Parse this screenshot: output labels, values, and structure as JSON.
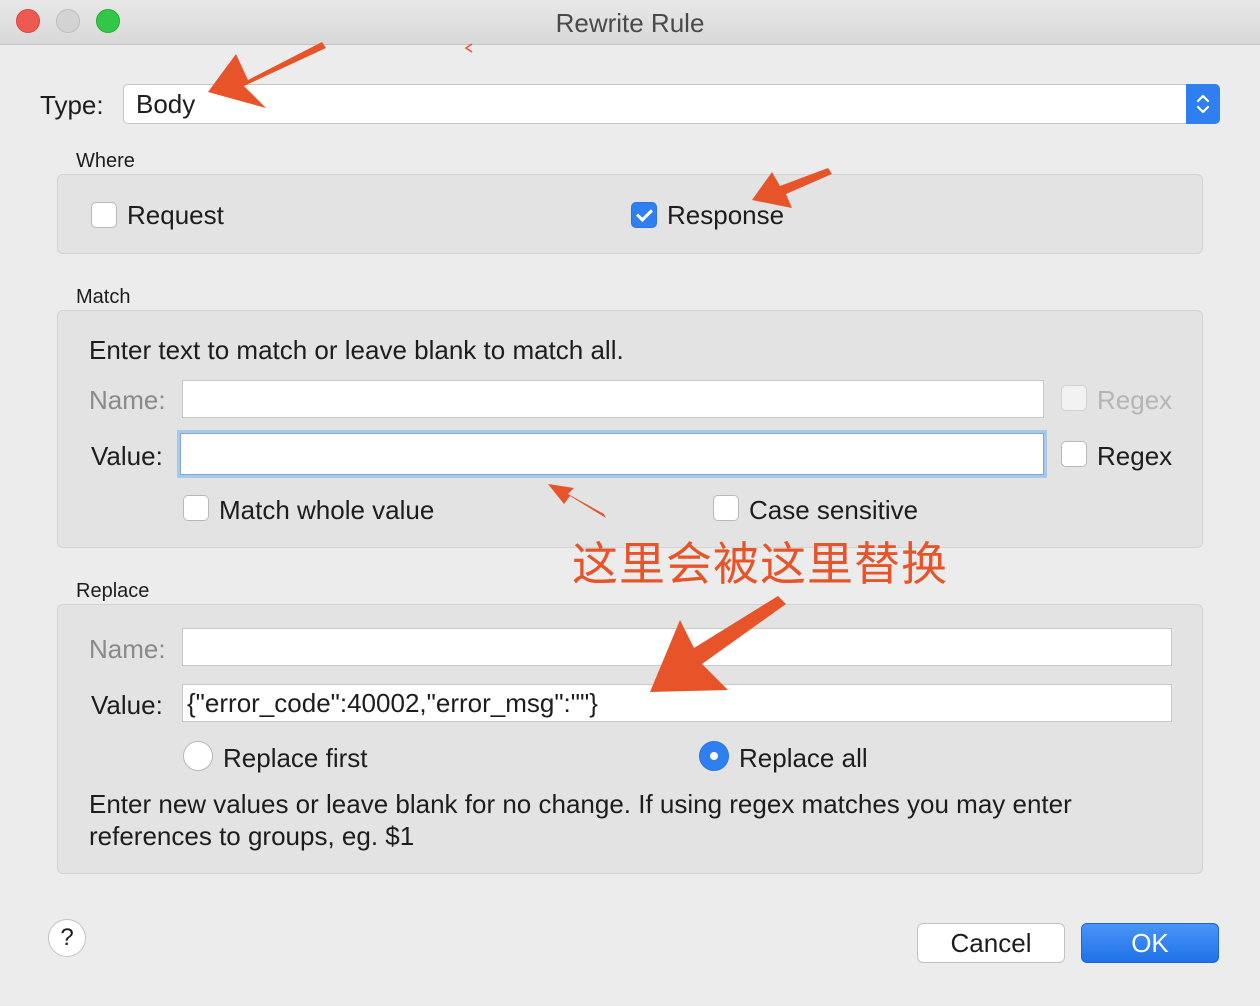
{
  "window": {
    "title": "Rewrite Rule"
  },
  "type": {
    "label": "Type:",
    "value": "Body"
  },
  "where": {
    "title": "Where",
    "request_label": "Request",
    "request_checked": false,
    "response_label": "Response",
    "response_checked": true
  },
  "match": {
    "title": "Match",
    "hint": "Enter text to match or leave blank to match all.",
    "name_label": "Name:",
    "name_value": "",
    "name_regex_label": "Regex",
    "value_label": "Value:",
    "value_value": "",
    "value_regex_label": "Regex",
    "match_whole_label": "Match whole value",
    "case_sensitive_label": "Case sensitive"
  },
  "replace": {
    "title": "Replace",
    "name_label": "Name:",
    "name_value": "",
    "value_label": "Value:",
    "value_value": "{\"error_code\":40002,\"error_msg\":\"\"}",
    "replace_first_label": "Replace first",
    "replace_all_label": "Replace all",
    "selected": "Replace all",
    "hint_line1": "Enter new values or leave blank for no change. If using regex matches you may enter",
    "hint_line2": "references to groups, eg. $1"
  },
  "buttons": {
    "help": "?",
    "cancel": "Cancel",
    "ok": "OK"
  },
  "annotation": {
    "text": "这里会被这里替换",
    "color": "#e8542a"
  },
  "colors": {
    "accent": "#2f7ff0",
    "annotation": "#e8542a"
  }
}
